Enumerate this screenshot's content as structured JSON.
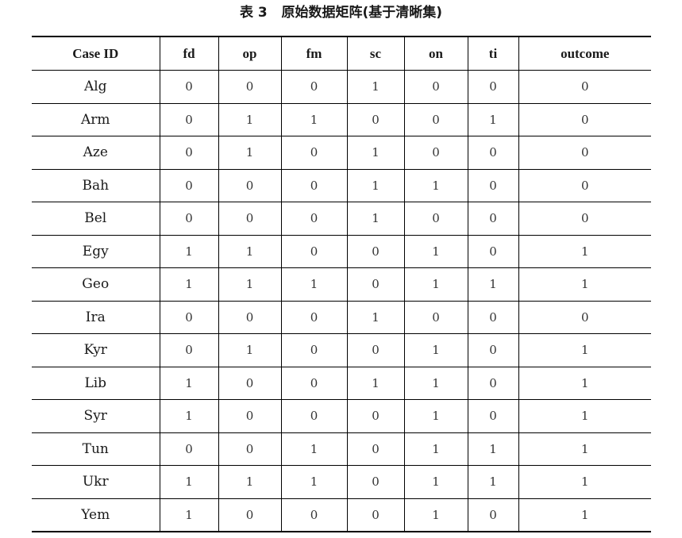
{
  "caption": "表 3   原始数据矩阵(基于清晰集)",
  "table": {
    "columns": [
      "Case ID",
      "fd",
      "op",
      "fm",
      "sc",
      "on",
      "ti",
      "outcome"
    ],
    "rows": [
      [
        "Alg",
        "0",
        "0",
        "0",
        "1",
        "0",
        "0",
        "0"
      ],
      [
        "Arm",
        "0",
        "1",
        "1",
        "0",
        "0",
        "1",
        "0"
      ],
      [
        "Aze",
        "0",
        "1",
        "0",
        "1",
        "0",
        "0",
        "0"
      ],
      [
        "Bah",
        "0",
        "0",
        "0",
        "1",
        "1",
        "0",
        "0"
      ],
      [
        "Bel",
        "0",
        "0",
        "0",
        "1",
        "0",
        "0",
        "0"
      ],
      [
        "Egy",
        "1",
        "1",
        "0",
        "0",
        "1",
        "0",
        "1"
      ],
      [
        "Geo",
        "1",
        "1",
        "1",
        "0",
        "1",
        "1",
        "1"
      ],
      [
        "Ira",
        "0",
        "0",
        "0",
        "1",
        "0",
        "0",
        "0"
      ],
      [
        "Kyr",
        "0",
        "1",
        "0",
        "0",
        "1",
        "0",
        "1"
      ],
      [
        "Lib",
        "1",
        "0",
        "0",
        "1",
        "1",
        "0",
        "1"
      ],
      [
        "Syr",
        "1",
        "0",
        "0",
        "0",
        "1",
        "0",
        "1"
      ],
      [
        "Tun",
        "0",
        "0",
        "1",
        "0",
        "1",
        "1",
        "1"
      ],
      [
        "Ukr",
        "1",
        "1",
        "1",
        "0",
        "1",
        "1",
        "1"
      ],
      [
        "Yem",
        "1",
        "0",
        "0",
        "0",
        "1",
        "0",
        "1"
      ]
    ]
  }
}
